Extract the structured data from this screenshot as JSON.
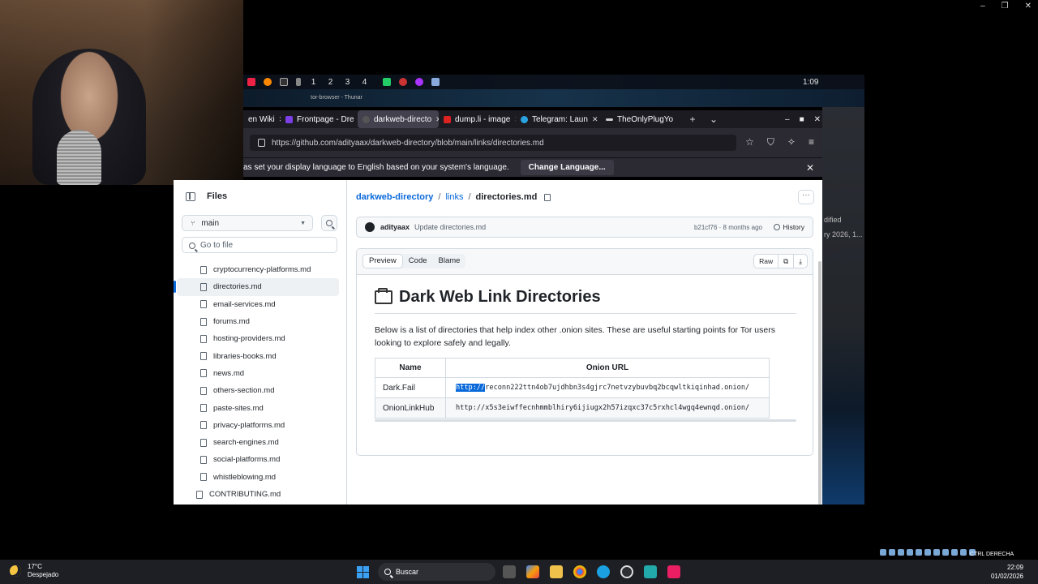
{
  "system_top": {
    "workspaces": [
      "1",
      "2",
      "3",
      "4"
    ],
    "clock": "1:09",
    "thunar_title": "tor-browser - Thunar"
  },
  "browser": {
    "tabs": [
      {
        "label": "en Wiki"
      },
      {
        "label": "Frontpage - Dre"
      },
      {
        "label": "darkweb-directo"
      },
      {
        "label": "dump.li - image"
      },
      {
        "label": "Telegram: Laun"
      },
      {
        "label": "TheOnlyPlugYo"
      }
    ],
    "new_tab": "+",
    "tab_list": "⌄",
    "url": "https://github.com/adityaax/darkweb-directory/blob/main/links/directories.md",
    "language_bar": {
      "message": "as set your display language to English based on your system's language.",
      "button": "Change Language..."
    }
  },
  "github": {
    "sidebar": {
      "title": "Files",
      "branch": "main",
      "goto_placeholder": "Go to file",
      "tree": [
        {
          "name": "cryptocurrency-platforms.md",
          "selected": false
        },
        {
          "name": "directories.md",
          "selected": true
        },
        {
          "name": "email-services.md",
          "selected": false
        },
        {
          "name": "forums.md",
          "selected": false
        },
        {
          "name": "hosting-providers.md",
          "selected": false
        },
        {
          "name": "libraries-books.md",
          "selected": false
        },
        {
          "name": "news.md",
          "selected": false
        },
        {
          "name": "others-section.md",
          "selected": false
        },
        {
          "name": "paste-sites.md",
          "selected": false
        },
        {
          "name": "privacy-platforms.md",
          "selected": false
        },
        {
          "name": "search-engines.md",
          "selected": false
        },
        {
          "name": "social-platforms.md",
          "selected": false
        },
        {
          "name": "whistleblowing.md",
          "selected": false
        }
      ],
      "root_file": "CONTRIBUTING.md"
    },
    "breadcrumb": {
      "repo": "darkweb-directory",
      "folder": "links",
      "file": "directories.md"
    },
    "commit": {
      "user": "adityaax",
      "message": "Update directories.md",
      "meta": "b21cf76 · 8 months ago",
      "history": "History"
    },
    "file_tabs": [
      "Preview",
      "Code",
      "Blame"
    ],
    "file_buttons": {
      "raw": "Raw"
    },
    "readme": {
      "title": "Dark Web Link Directories",
      "intro": "Below is a list of directories that help index other .onion sites. These are useful starting points for Tor users looking to explore safely and legally.",
      "table_headers": [
        "Name",
        "Onion URL"
      ],
      "rows": [
        {
          "name": "Dark.Fail",
          "url_selected": "http://",
          "url_rest": "reconn222ttn4ob7ujdhbn3s4gjrc7netvzybuvbq2bcqwltkiqinhad.onion/"
        },
        {
          "name": "OnionLinkHub",
          "url_selected": "",
          "url_rest": "http://x5s3eiwffecnhmmblhiry6ijiugx2h57izqxc37c5rxhcl4wgq4ewnqd.onion/"
        }
      ]
    }
  },
  "right_bg": {
    "t1": "dified",
    "t2": "ry 2026, 1..."
  },
  "taskbar": {
    "weather_temp": "17°C",
    "weather_desc": "Despejado",
    "search": "Buscar",
    "kb": "CTRL DERECHA",
    "time": "22:09",
    "date": "01/02/2026"
  }
}
